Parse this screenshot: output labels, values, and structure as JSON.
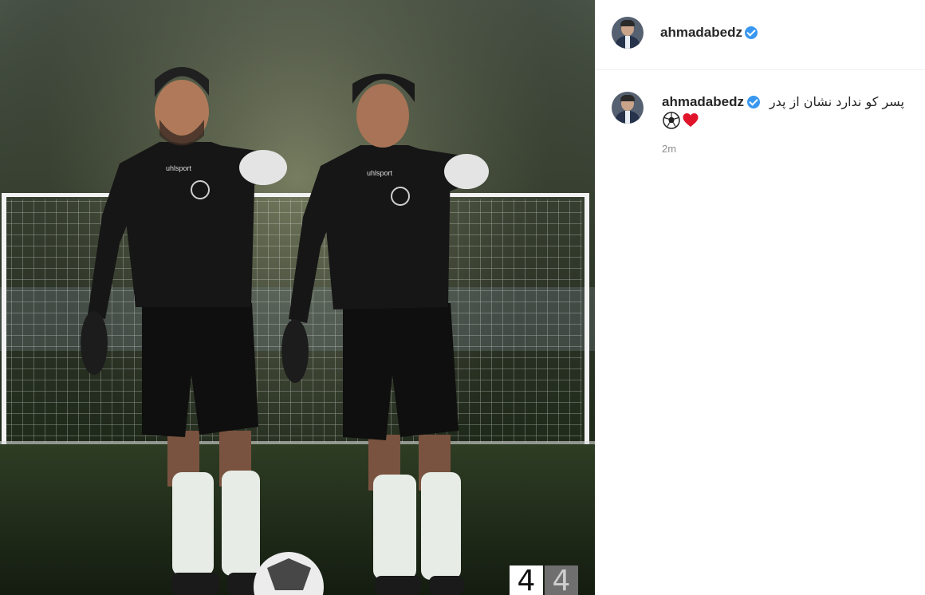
{
  "post": {
    "username": "ahmadabedz",
    "verified": true,
    "caption": "پسر کو ندارد نشان از پدر",
    "caption_emojis": [
      "soccer-ball",
      "red-heart"
    ],
    "timestamp": "2m"
  },
  "photo": {
    "counter_current": "4",
    "counter_total": "4",
    "jersey_text": "uhlsport"
  },
  "colors": {
    "verified_badge": "#3897f0",
    "username_text": "#262626",
    "timestamp_text": "#8e8e8e",
    "heart": "#e0152b"
  }
}
